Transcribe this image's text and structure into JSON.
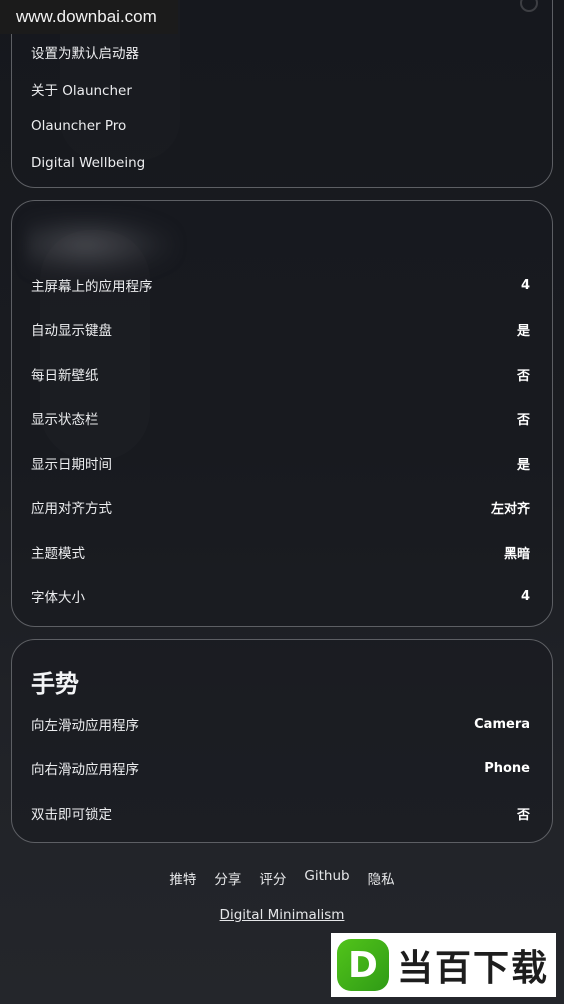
{
  "watermark_top": "www.downbai.com",
  "card1": {
    "items": [
      {
        "label": "设置为默认启动器"
      },
      {
        "label": "关于 Olauncher"
      },
      {
        "label": "Olauncher Pro"
      },
      {
        "label": "Digital Wellbeing"
      }
    ]
  },
  "card2": {
    "items": [
      {
        "label": "主屏幕上的应用程序",
        "value": "4"
      },
      {
        "label": "自动显示键盘",
        "value": "是"
      },
      {
        "label": "每日新壁纸",
        "value": "否"
      },
      {
        "label": "显示状态栏",
        "value": "否"
      },
      {
        "label": "显示日期时间",
        "value": "是"
      },
      {
        "label": "应用对齐方式",
        "value": "左对齐"
      },
      {
        "label": "主题模式",
        "value": "黑暗"
      },
      {
        "label": "字体大小",
        "value": "4"
      }
    ]
  },
  "card3": {
    "title": "手势",
    "items": [
      {
        "label": "向左滑动应用程序",
        "value": "Camera"
      },
      {
        "label": "向右滑动应用程序",
        "value": "Phone"
      },
      {
        "label": "双击即可锁定",
        "value": "否"
      }
    ]
  },
  "footer": {
    "links": [
      "推特",
      "分享",
      "评分",
      "Github",
      "隐私"
    ],
    "tagline": "Digital Minimalism"
  },
  "watermark_bottom": {
    "logo_letter": "D",
    "text": "当百下载"
  }
}
